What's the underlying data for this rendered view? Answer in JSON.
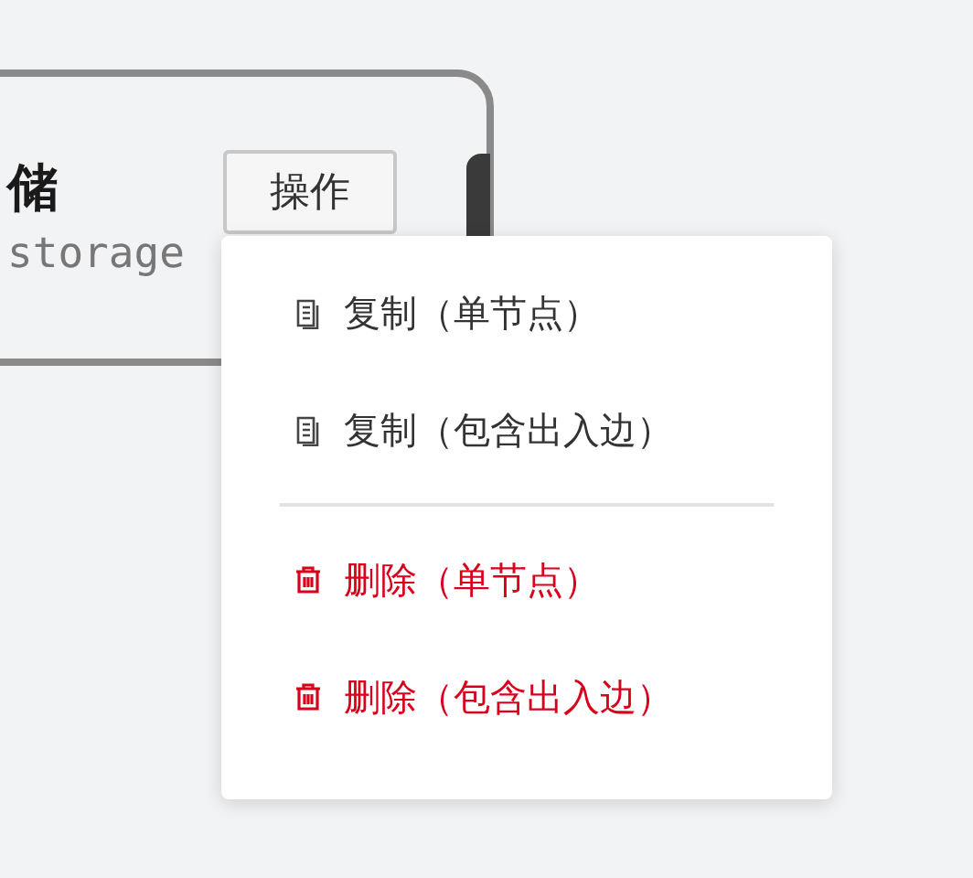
{
  "node": {
    "title": "储",
    "subtitle": "storage",
    "action_button": "操作"
  },
  "menu": {
    "groups": [
      [
        {
          "kind": "copy",
          "label": "复制（单节点）"
        },
        {
          "kind": "copy",
          "label": "复制（包含出入边）"
        }
      ],
      [
        {
          "kind": "delete",
          "label": "删除（单节点）"
        },
        {
          "kind": "delete",
          "label": "删除（包含出入边）"
        }
      ]
    ]
  }
}
